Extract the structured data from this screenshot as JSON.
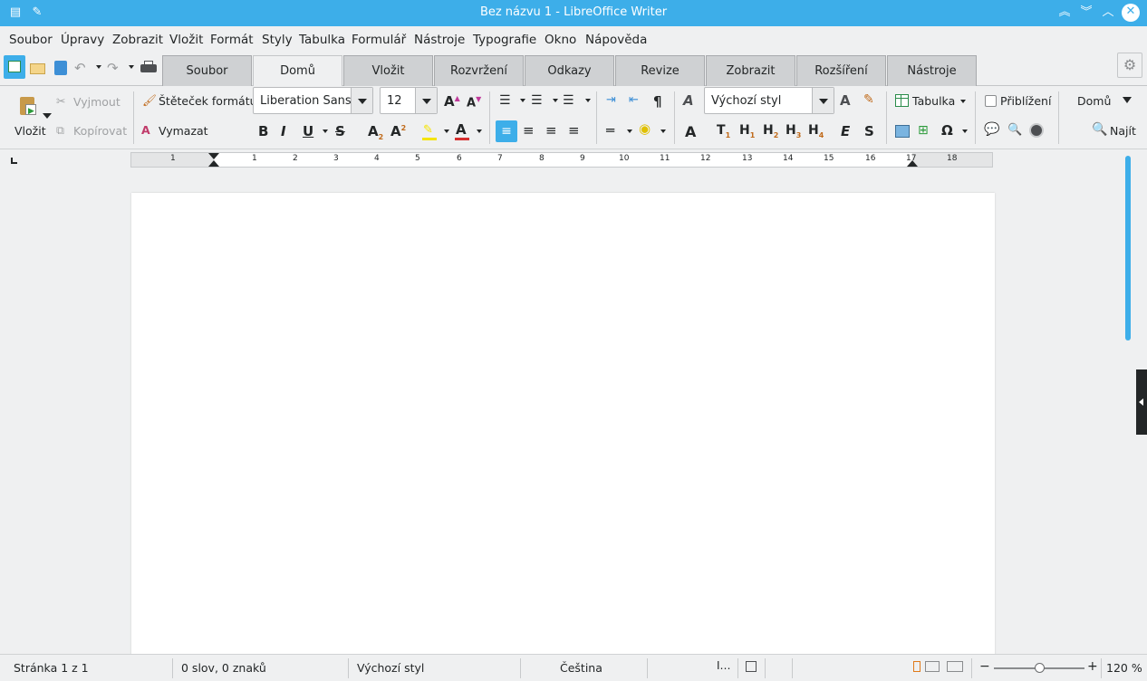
{
  "window": {
    "title": "Bez názvu 1 - LibreOffice Writer"
  },
  "menu": [
    "Soubor",
    "Úpravy",
    "Zobrazit",
    "Vložit",
    "Formát",
    "Styly",
    "Tabulka",
    "Formulář",
    "Nástroje",
    "Typografie",
    "Okno",
    "Nápověda"
  ],
  "tabs": [
    "Soubor",
    "Domů",
    "Vložit",
    "Rozvržení",
    "Odkazy",
    "Revize",
    "Zobrazit",
    "Rozšíření",
    "Nástroje"
  ],
  "active_tab": "Domů",
  "ribbon": {
    "paste_label": "Vložit",
    "cut_label": "Vyjmout",
    "copy_label": "Kopírovat",
    "clone_label": "Štěteček formátu",
    "clear_label": "Vymazat",
    "font_name": "Liberation Sans",
    "font_size": "12",
    "paragraph_style": "Výchozí styl",
    "table_label": "Tabulka",
    "zoom_checkbox_label": "Přiblížení",
    "tab_selector": "Domů",
    "find_label": "Najít"
  },
  "ruler": {
    "numbers": [
      "1",
      "1",
      "2",
      "3",
      "4",
      "5",
      "6",
      "7",
      "8",
      "9",
      "10",
      "11",
      "12",
      "13",
      "14",
      "15",
      "16",
      "17",
      "18"
    ]
  },
  "status": {
    "page": "Stránka 1 z 1",
    "words": "0 slov, 0 znaků",
    "style": "Výchozí styl",
    "language": "Čeština",
    "zoom": "120 %"
  },
  "colors": {
    "accent": "#3daee9",
    "background": "#eff0f1",
    "highlight": "#f5e400",
    "font_color": "#d62e2e"
  }
}
